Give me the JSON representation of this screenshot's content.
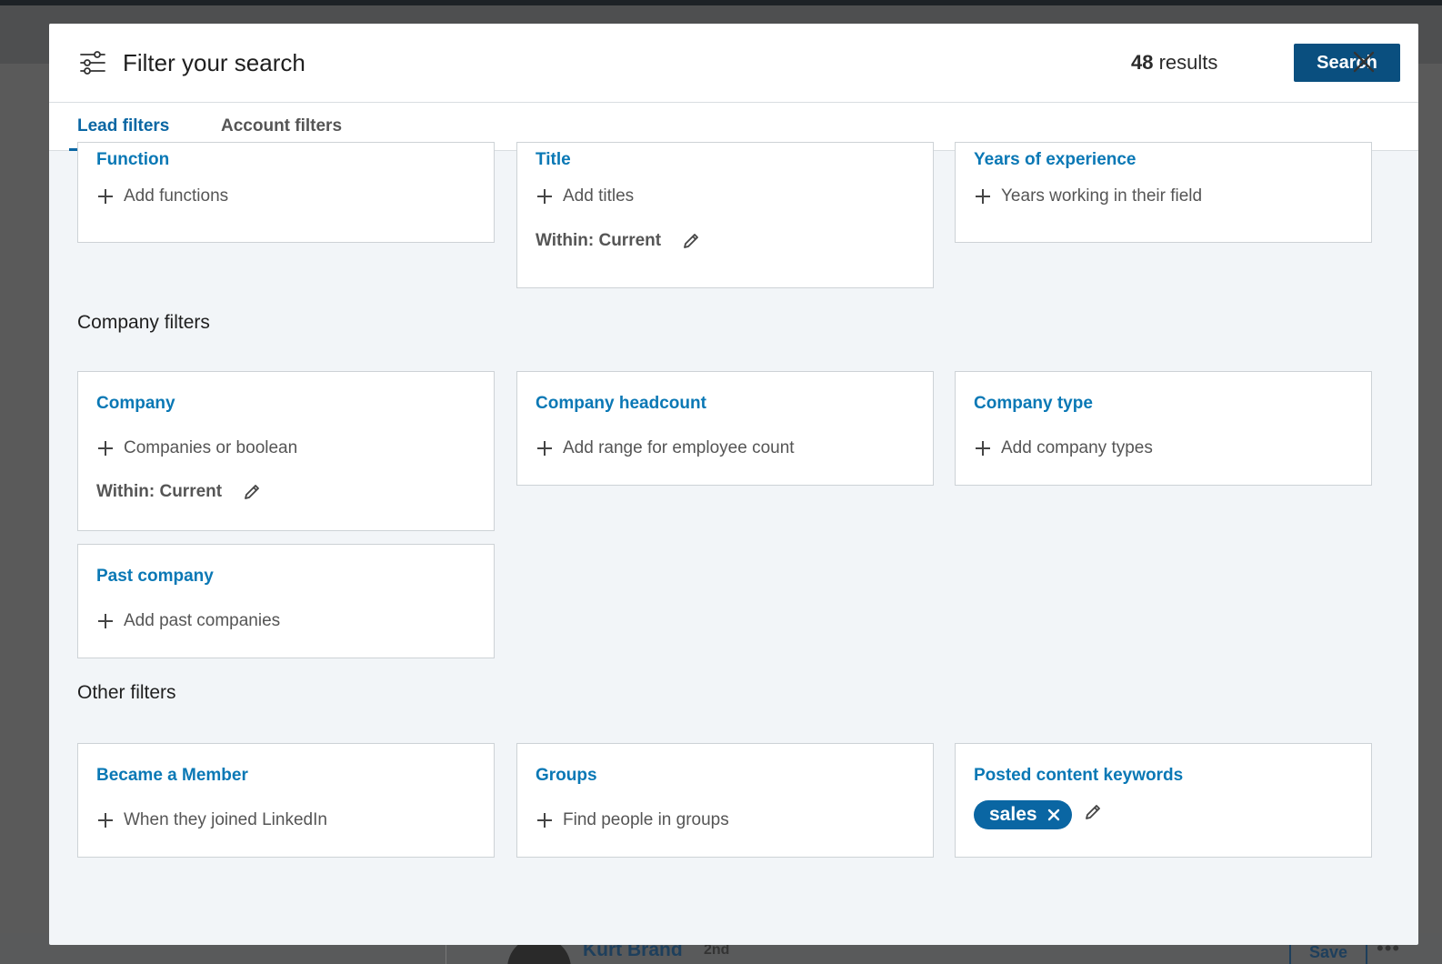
{
  "background": {
    "person_name": "Kurt Brand",
    "degree": "2nd",
    "save_label": "Save",
    "more_label": "•••"
  },
  "header": {
    "title": "Filter your search",
    "results_count": "48",
    "results_label": " results",
    "search_label": "Search"
  },
  "tabs": [
    {
      "label": "Lead filters",
      "active": true
    },
    {
      "label": "Account filters",
      "active": false
    }
  ],
  "lead_cards": {
    "function": {
      "title": "Function",
      "add": "Add functions"
    },
    "title": {
      "title": "Title",
      "add": "Add titles",
      "within": "Within: Current"
    },
    "years": {
      "title": "Years of experience",
      "add": "Years working in their field"
    }
  },
  "company_section": {
    "heading": "Company filters",
    "company": {
      "title": "Company",
      "add": "Companies or boolean",
      "within": "Within: Current"
    },
    "headcount": {
      "title": "Company headcount",
      "add": "Add range for employee count"
    },
    "type": {
      "title": "Company type",
      "add": "Add company types"
    },
    "past": {
      "title": "Past company",
      "add": "Add past companies"
    }
  },
  "other_section": {
    "heading": "Other filters",
    "member": {
      "title": "Became a Member",
      "add": "When they joined LinkedIn"
    },
    "groups": {
      "title": "Groups",
      "add": "Find people in groups"
    },
    "keywords": {
      "title": "Posted content keywords",
      "pill": "sales"
    }
  },
  "colors": {
    "accent": "#0a66a3",
    "title_blue": "#0a78b5",
    "primary_button": "#0a4f7f",
    "modal_bg": "#f2f5f8"
  }
}
